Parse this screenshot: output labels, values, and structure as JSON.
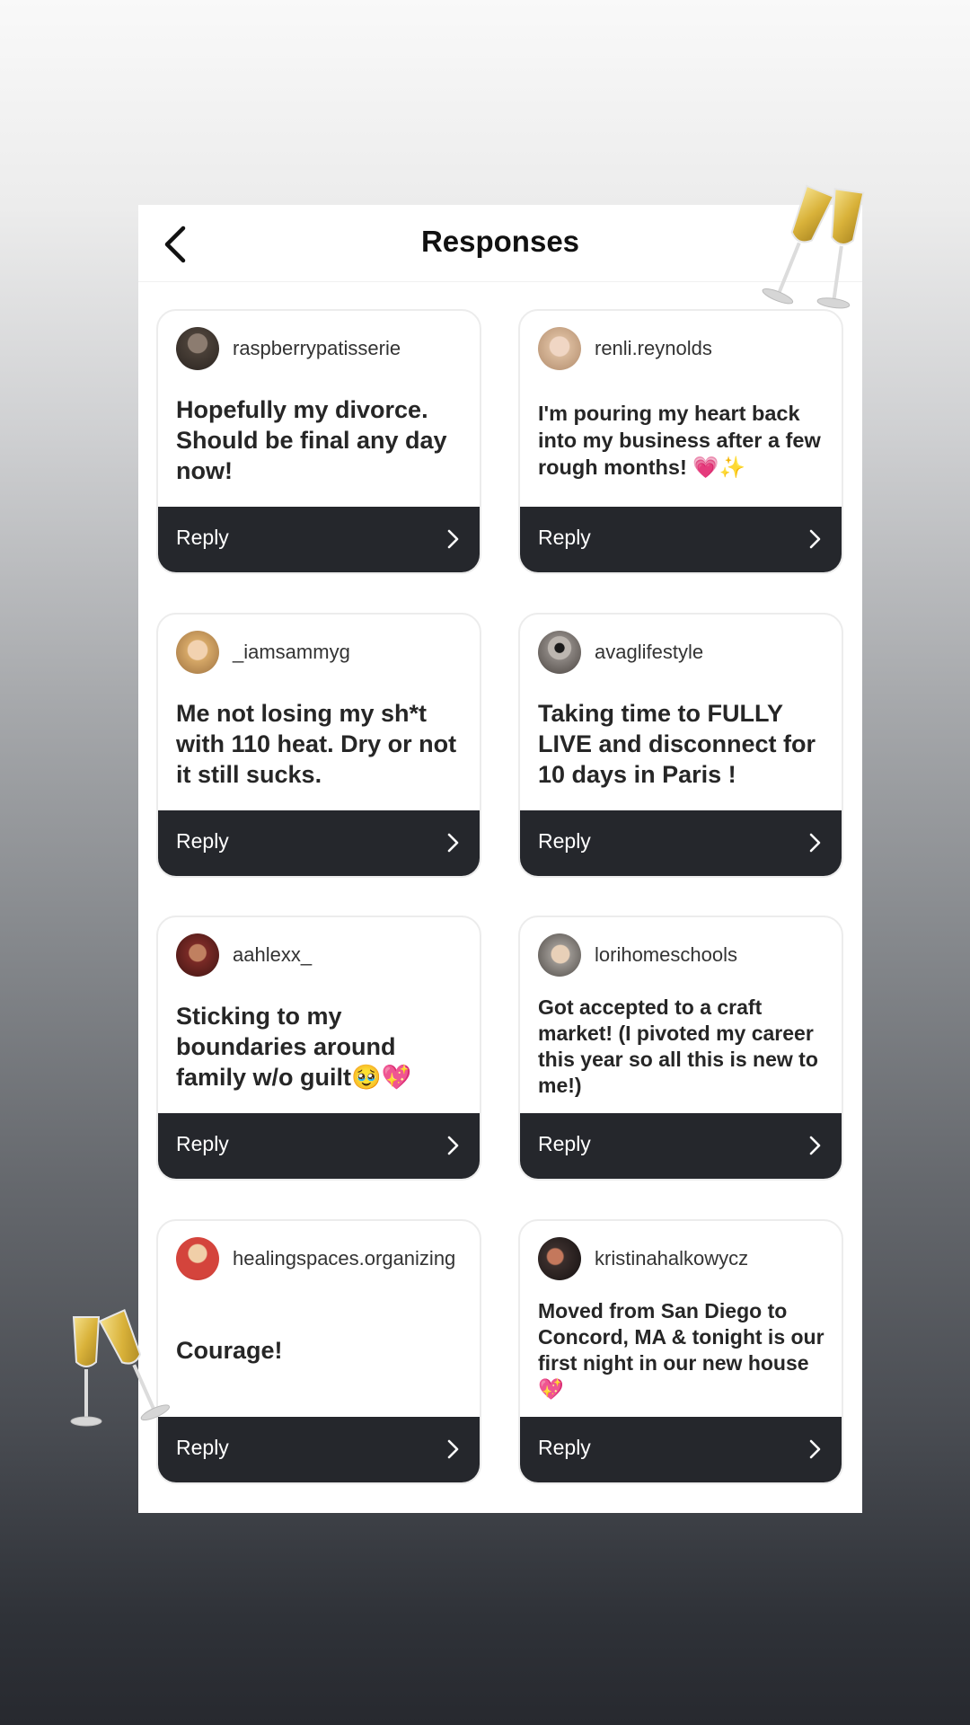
{
  "header": {
    "title": "Responses",
    "back_icon": "chevron-left-icon"
  },
  "reply_label": "Reply",
  "reply_icon": "chevron-right-icon",
  "decoration_icon": "champagne-glasses-icon",
  "responses": [
    {
      "username": "raspberrypatisserie",
      "message": "Hopefully my divorce. Should be final any day now!",
      "avatar_color": "#4a4038"
    },
    {
      "username": "renli.reynolds",
      "message": "I'm pouring my heart back into my business after a few rough months! 💗✨",
      "avatar_color": "#c9a58d"
    },
    {
      "username": "_iamsammyg",
      "message": "Me not losing my sh*t with 110 heat.   Dry or not it still sucks.",
      "avatar_color": "#c79a5e"
    },
    {
      "username": "avaglifestyle",
      "message": "Taking time to FULLY LIVE and disconnect for 10 days in Paris !",
      "avatar_color": "#8a8480"
    },
    {
      "username": "aahlexx_",
      "message": "Sticking to my boundaries around family w/o guilt🥹💖",
      "avatar_color": "#7a2a26"
    },
    {
      "username": "lorihomeschools",
      "message": "Got accepted to a craft market! (I pivoted my career this year so all this is new to me!)",
      "avatar_color": "#6d6a66"
    },
    {
      "username": "healingspaces.organizing",
      "message": "Courage!",
      "avatar_color": "#c94a4a"
    },
    {
      "username": "kristinahalkowycz",
      "message": "Moved from San Diego to Concord, MA & tonight is our first night in our new house💖",
      "avatar_color": "#3a2e2c"
    }
  ]
}
